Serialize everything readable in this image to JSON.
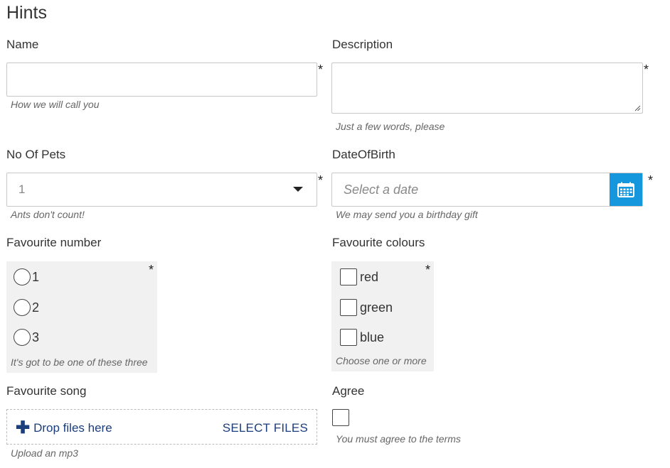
{
  "page": {
    "title": "Hints"
  },
  "required_marker": "*",
  "name": {
    "label": "Name",
    "value": "",
    "hint": "How we will call you"
  },
  "description": {
    "label": "Description",
    "value": "",
    "hint": "Just a few words, please"
  },
  "pets": {
    "label": "No Of Pets",
    "value": "1",
    "hint": "Ants don't count!"
  },
  "dob": {
    "label": "DateOfBirth",
    "placeholder": "Select a date",
    "hint": "We may send you a birthday gift",
    "button_icon": "calendar-icon",
    "button_color": "#1497dc"
  },
  "fav_number": {
    "label": "Favourite number",
    "options": [
      "1",
      "2",
      "3"
    ],
    "hint": "It's got to be one of these three"
  },
  "fav_colours": {
    "label": "Favourite colours",
    "options": [
      "red",
      "green",
      "blue"
    ],
    "hint": "Choose one or more"
  },
  "song": {
    "label": "Favourite song",
    "drop_text": "Drop files here",
    "select_text": "SELECT FILES",
    "hint": "Upload an mp3",
    "plus_icon": "plus-icon"
  },
  "agree": {
    "label": "Agree",
    "hint": "You must agree to the terms",
    "checked": false
  },
  "colors": {
    "accent": "#1497dc",
    "link": "#1a3d7c",
    "group_bg": "#f1f1f1"
  }
}
